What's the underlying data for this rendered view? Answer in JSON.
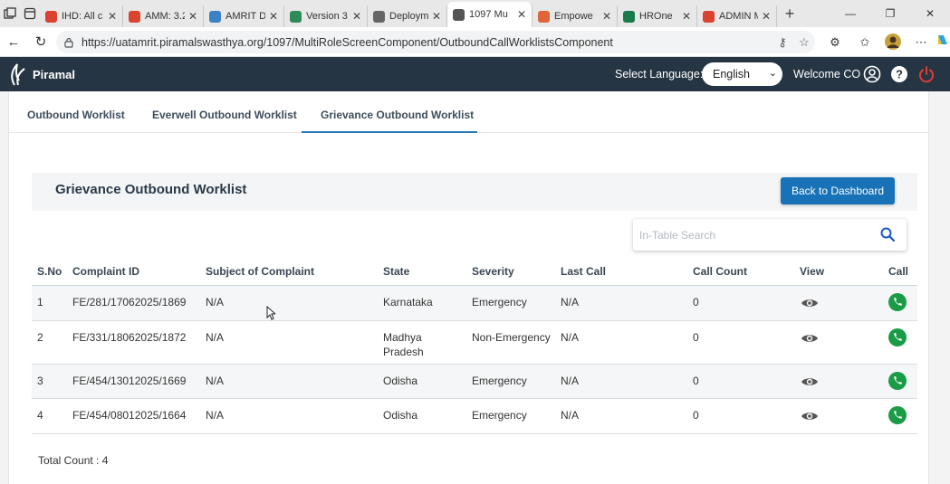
{
  "browser": {
    "tabs": [
      {
        "title": "IHD: All c",
        "color": "#d9432f",
        "active": false
      },
      {
        "title": "AMM: 3.2",
        "color": "#d9432f",
        "active": false
      },
      {
        "title": "AMRIT D",
        "color": "#3b82c4",
        "active": false
      },
      {
        "title": "Version 3",
        "color": "#2e8b57",
        "active": false
      },
      {
        "title": "Deploym",
        "color": "#666666",
        "active": false
      },
      {
        "title": "1097 Mu",
        "color": "#555555",
        "active": true
      },
      {
        "title": "Empowe",
        "color": "#e0653a",
        "active": false
      },
      {
        "title": "HROne",
        "color": "#1a7a4c",
        "active": false
      },
      {
        "title": "ADMIN M",
        "color": "#d9432f",
        "active": false
      }
    ],
    "url": "https://uatamrit.piramalswasthya.org/1097/MultiRoleScreenComponent/OutboundCallWorklistsComponent"
  },
  "header": {
    "brand": "Piramal",
    "language_label": "Select Language:",
    "language_value": "English",
    "welcome": "Welcome CO"
  },
  "worklist_tabs": [
    {
      "label": "Outbound Worklist"
    },
    {
      "label": "Everwell Outbound Worklist"
    },
    {
      "label": "Grievance Outbound Worklist"
    }
  ],
  "card": {
    "title": "Grievance Outbound Worklist",
    "back_button": "Back to Dashboard",
    "search_placeholder": "In-Table Search"
  },
  "table": {
    "columns": [
      "S.No",
      "Complaint ID",
      "Subject of Complaint",
      "State",
      "Severity",
      "Last Call",
      "Call Count",
      "View",
      "Call"
    ],
    "rows": [
      {
        "sno": "1",
        "complaint_id": "FE/281/17062025/1869",
        "subject": "N/A",
        "state": "Karnataka",
        "severity": "Emergency",
        "last_call": "N/A",
        "call_count": "0"
      },
      {
        "sno": "2",
        "complaint_id": "FE/331/18062025/1872",
        "subject": "N/A",
        "state": "Madhya Pradesh",
        "severity": "Non-Emergency",
        "last_call": "N/A",
        "call_count": "0"
      },
      {
        "sno": "3",
        "complaint_id": "FE/454/13012025/1669",
        "subject": "N/A",
        "state": "Odisha",
        "severity": "Emergency",
        "last_call": "N/A",
        "call_count": "0"
      },
      {
        "sno": "4",
        "complaint_id": "FE/454/08012025/1664",
        "subject": "N/A",
        "state": "Odisha",
        "severity": "Emergency",
        "last_call": "N/A",
        "call_count": "0"
      }
    ],
    "total_count": "Total Count : 4"
  },
  "colors": {
    "header_bg": "#263544",
    "primary_button": "#1872b8",
    "call_green": "#1a9b46",
    "power_red": "#e53935"
  }
}
